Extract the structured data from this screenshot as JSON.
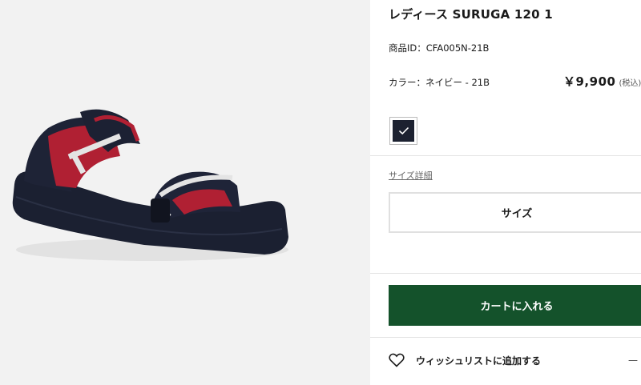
{
  "product": {
    "title": "レディース SURUGA 120 1",
    "id_text": "商品ID：CFA005N-21B",
    "color_text": "カラー：ネイビー - 21B",
    "price": "￥9,900",
    "tax_note": "(税込)"
  },
  "color_swatch": {
    "selected_color": "#1c2130",
    "icon": "check-icon"
  },
  "size_guide": {
    "label": "サイズ詳細"
  },
  "size_select": {
    "label": "サイズ"
  },
  "cart": {
    "button_label": "カートに入れる",
    "color": "#14522b"
  },
  "wishlist": {
    "label": "ウィッシュリストに追加する",
    "icon": "heart-icon",
    "trail": "—"
  }
}
